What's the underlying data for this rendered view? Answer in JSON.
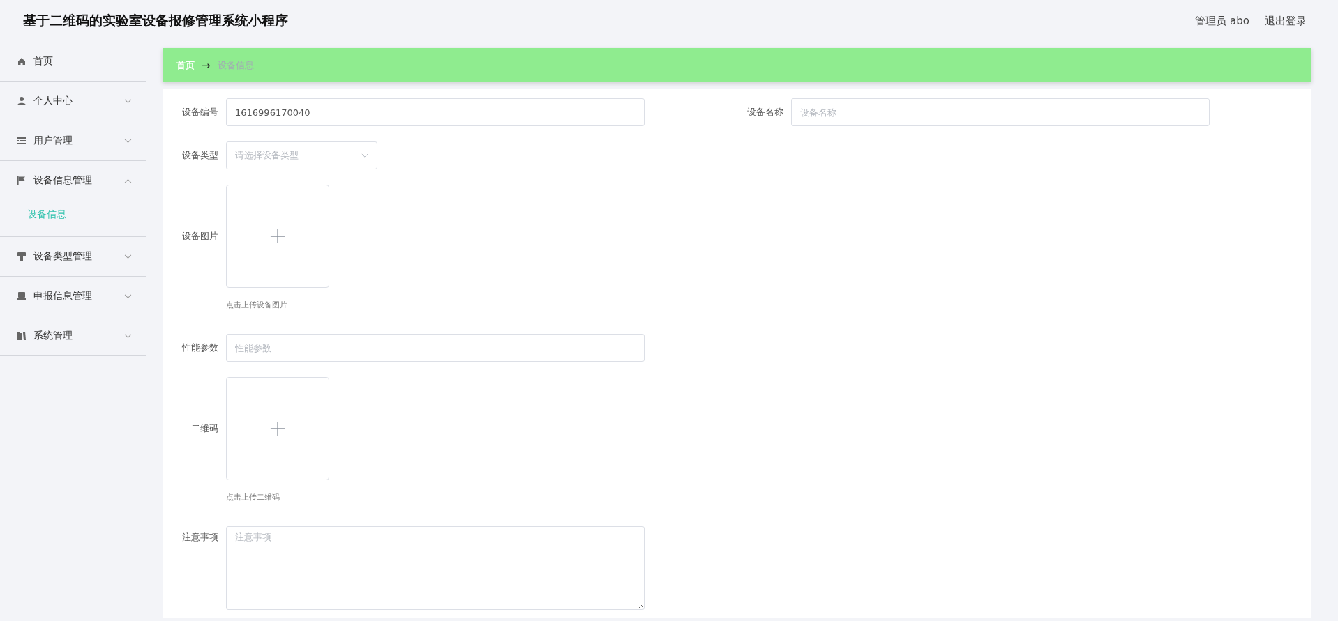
{
  "header": {
    "title": "基于二维码的实验室设备报修管理系统小程序",
    "user": "管理员 abo",
    "logout": "退出登录"
  },
  "sidebar": {
    "items": [
      {
        "label": "首页",
        "kind": "link"
      },
      {
        "label": "个人中心",
        "kind": "menu",
        "expanded": false
      },
      {
        "label": "用户管理",
        "kind": "menu",
        "expanded": false
      },
      {
        "label": "设备信息管理",
        "kind": "menu",
        "expanded": true,
        "children": [
          {
            "label": "设备信息",
            "selected": true
          }
        ]
      },
      {
        "label": "设备类型管理",
        "kind": "menu",
        "expanded": false
      },
      {
        "label": "申报信息管理",
        "kind": "menu",
        "expanded": false
      },
      {
        "label": "系统管理",
        "kind": "menu",
        "expanded": false
      }
    ]
  },
  "breadcrumb": {
    "items": [
      {
        "label": "首页",
        "selected": false
      },
      {
        "label": "设备信息",
        "selected": true
      }
    ],
    "separator": "→"
  },
  "form": {
    "rows": [
      {
        "fields": [
          {
            "kind": "text",
            "label": "设备编号",
            "value": "1616996170040"
          },
          {
            "kind": "text",
            "label": "设备名称",
            "placeholder": "设备名称"
          }
        ]
      },
      {
        "fields": [
          {
            "kind": "select",
            "label": "设备类型",
            "placeholder": "请选择设备类型"
          }
        ]
      },
      {
        "fields": [
          {
            "kind": "upload",
            "label": "设备图片",
            "hint": "点击上传设备图片"
          }
        ]
      },
      {
        "fields": [
          {
            "kind": "text",
            "label": "性能参数",
            "placeholder": "性能参数"
          }
        ]
      },
      {
        "fields": [
          {
            "kind": "upload",
            "label": "二维码",
            "hint": "点击上传二维码"
          }
        ]
      },
      {
        "fields": [
          {
            "kind": "textarea",
            "label": "注意事项",
            "placeholder": "注意事项"
          }
        ]
      }
    ]
  }
}
